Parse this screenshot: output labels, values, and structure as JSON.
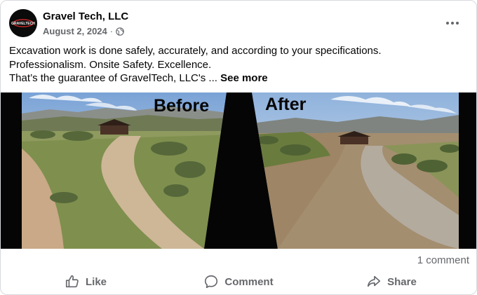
{
  "post": {
    "author": "Gravel Tech, LLC",
    "date": "August 2, 2024",
    "separator": "·",
    "text_lines": [
      "Excavation work is done safely, accurately, and according to your specifications.",
      "Professionalism. Onsite Safety. Excellence."
    ],
    "truncated_line": "That’s the guarantee of GravelTech, LLC's ...",
    "see_more": "See more",
    "image_labels": {
      "before": "Before",
      "after": "After"
    },
    "avatar_logo_text": "GRAVELTECH"
  },
  "stats": {
    "comments": "1 comment"
  },
  "actions": {
    "like": "Like",
    "comment": "Comment",
    "share": "Share"
  },
  "icons": {
    "more": "more-horizontal-icon",
    "audience": "globe-icon",
    "like": "thumbs-up-icon",
    "comment": "comment-bubble-icon",
    "share": "share-arrow-icon"
  },
  "colors": {
    "secondary_text": "#65676b",
    "primary_text": "#050505",
    "border": "#d8dadf"
  }
}
